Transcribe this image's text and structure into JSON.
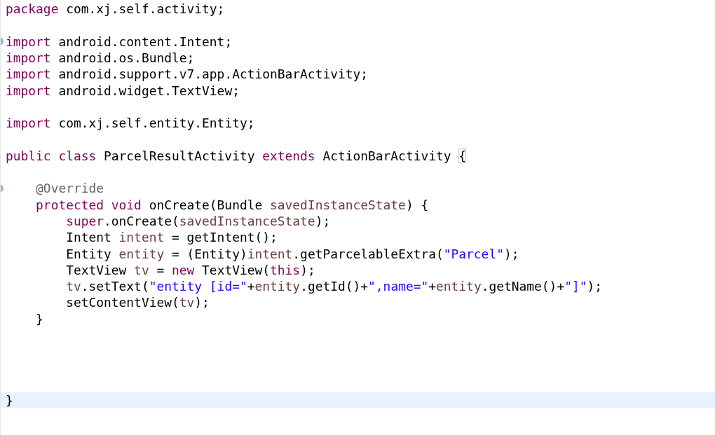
{
  "editor": {
    "lines": [
      {
        "current": false,
        "fold": false,
        "tokens": [
          {
            "kind": "keyword",
            "text": "package"
          },
          {
            "kind": "plain",
            "text": " com.xj.self.activity;"
          }
        ]
      },
      {
        "current": false,
        "fold": false
      },
      {
        "current": false,
        "fold": true,
        "tokens": [
          {
            "kind": "keyword",
            "text": "import"
          },
          {
            "kind": "plain",
            "text": " android.content.Intent;"
          }
        ]
      },
      {
        "current": false,
        "fold": false,
        "tokens": [
          {
            "kind": "keyword",
            "text": "import"
          },
          {
            "kind": "plain",
            "text": " android.os.Bundle;"
          }
        ]
      },
      {
        "current": false,
        "fold": false,
        "tokens": [
          {
            "kind": "keyword",
            "text": "import"
          },
          {
            "kind": "plain",
            "text": " android.support.v7.app.ActionBarActivity;"
          }
        ]
      },
      {
        "current": false,
        "fold": false,
        "tokens": [
          {
            "kind": "keyword",
            "text": "import"
          },
          {
            "kind": "plain",
            "text": " android.widget.TextView;"
          }
        ]
      },
      {
        "current": false,
        "fold": false
      },
      {
        "current": false,
        "fold": false,
        "tokens": [
          {
            "kind": "keyword",
            "text": "import"
          },
          {
            "kind": "plain",
            "text": " com.xj.self.entity.Entity;"
          }
        ]
      },
      {
        "current": false,
        "fold": false
      },
      {
        "current": false,
        "fold": false,
        "tokens": [
          {
            "kind": "keyword",
            "text": "public "
          },
          {
            "kind": "keyword",
            "text": "class"
          },
          {
            "kind": "plain",
            "text": " ParcelResultActivity "
          },
          {
            "kind": "keyword",
            "text": "extends"
          },
          {
            "kind": "plain",
            "text": " ActionBarActivity "
          },
          {
            "kind": "matched",
            "text": "{"
          }
        ]
      },
      {
        "current": false,
        "fold": false
      },
      {
        "current": false,
        "fold": true,
        "tokens": [
          {
            "kind": "annotation",
            "text": "    @Override"
          }
        ]
      },
      {
        "current": false,
        "fold": false,
        "tokens": [
          {
            "kind": "keyword",
            "text": "    protected "
          },
          {
            "kind": "keyword",
            "text": "void"
          },
          {
            "kind": "plain",
            "text": " onCreate(Bundle "
          },
          {
            "kind": "variable",
            "text": "savedInstanceState"
          },
          {
            "kind": "plain",
            "text": ") {"
          }
        ]
      },
      {
        "current": false,
        "fold": false,
        "tokens": [
          {
            "kind": "keyword",
            "text": "        super"
          },
          {
            "kind": "plain",
            "text": ".onCreate("
          },
          {
            "kind": "variable",
            "text": "savedInstanceState"
          },
          {
            "kind": "plain",
            "text": ");"
          }
        ]
      },
      {
        "current": false,
        "fold": false,
        "tokens": [
          {
            "kind": "plain",
            "text": "        Intent "
          },
          {
            "kind": "variable",
            "text": "intent"
          },
          {
            "kind": "plain",
            "text": " = getIntent();"
          }
        ]
      },
      {
        "current": false,
        "fold": false,
        "tokens": [
          {
            "kind": "plain",
            "text": "        Entity "
          },
          {
            "kind": "variable",
            "text": "entity"
          },
          {
            "kind": "plain",
            "text": " = (Entity)"
          },
          {
            "kind": "variable",
            "text": "intent"
          },
          {
            "kind": "plain",
            "text": ".getParcelableExtra("
          },
          {
            "kind": "string",
            "text": "\"Parcel\""
          },
          {
            "kind": "plain",
            "text": ");"
          }
        ]
      },
      {
        "current": false,
        "fold": false,
        "tokens": [
          {
            "kind": "plain",
            "text": "        TextView "
          },
          {
            "kind": "variable",
            "text": "tv"
          },
          {
            "kind": "plain",
            "text": " = "
          },
          {
            "kind": "keyword",
            "text": "new"
          },
          {
            "kind": "plain",
            "text": " TextView("
          },
          {
            "kind": "keyword",
            "text": "this"
          },
          {
            "kind": "plain",
            "text": ");"
          }
        ]
      },
      {
        "current": false,
        "fold": false,
        "tokens": [
          {
            "kind": "variable",
            "text": "        tv"
          },
          {
            "kind": "plain",
            "text": ".setText("
          },
          {
            "kind": "string",
            "text": "\"entity [id=\""
          },
          {
            "kind": "plain",
            "text": "+"
          },
          {
            "kind": "variable",
            "text": "entity"
          },
          {
            "kind": "plain",
            "text": ".getId()+"
          },
          {
            "kind": "string",
            "text": "\",name=\""
          },
          {
            "kind": "plain",
            "text": "+"
          },
          {
            "kind": "variable",
            "text": "entity"
          },
          {
            "kind": "plain",
            "text": ".getName()+"
          },
          {
            "kind": "string",
            "text": "\"]\""
          },
          {
            "kind": "plain",
            "text": ");"
          }
        ]
      },
      {
        "current": false,
        "fold": false,
        "tokens": [
          {
            "kind": "plain",
            "text": "        setContentView("
          },
          {
            "kind": "variable",
            "text": "tv"
          },
          {
            "kind": "plain",
            "text": ");"
          }
        ]
      },
      {
        "current": false,
        "fold": false,
        "tokens": [
          {
            "kind": "plain",
            "text": "    }"
          }
        ]
      },
      {
        "current": false,
        "fold": false
      },
      {
        "current": false,
        "fold": false
      },
      {
        "current": false,
        "fold": false
      },
      {
        "current": false,
        "fold": false
      },
      {
        "current": true,
        "fold": false,
        "tokens": [
          {
            "kind": "plain",
            "text": "}"
          }
        ]
      }
    ]
  }
}
